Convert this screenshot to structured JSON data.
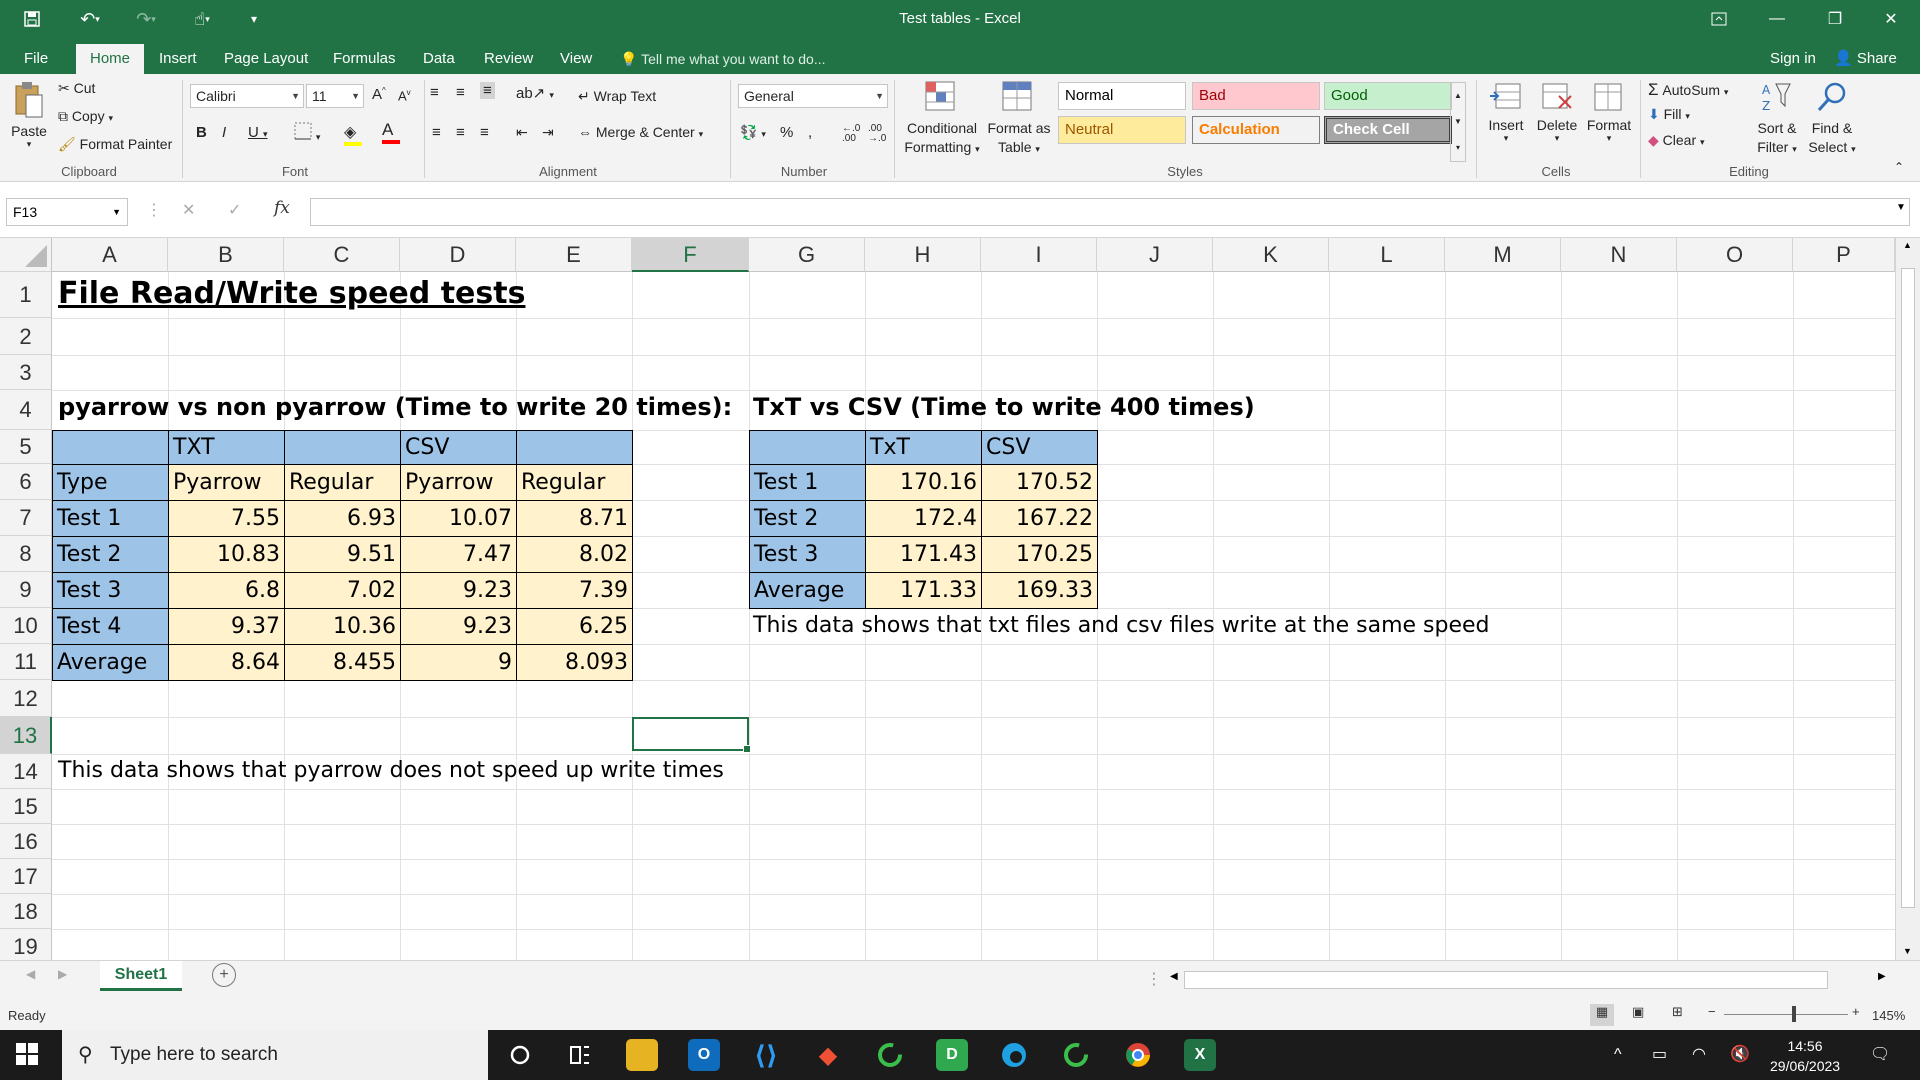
{
  "window": {
    "title": "Test tables - Excel"
  },
  "tabs": [
    "File",
    "Home",
    "Insert",
    "Page Layout",
    "Formulas",
    "Data",
    "Review",
    "View"
  ],
  "tell_me": "Tell me what you want to do...",
  "account": {
    "sign_in": "Sign in",
    "share": "Share"
  },
  "ribbon": {
    "clipboard": {
      "paste": "Paste",
      "cut": "Cut",
      "copy": "Copy",
      "format_painter": "Format Painter",
      "label": "Clipboard"
    },
    "font": {
      "name": "Calibri",
      "size": "11",
      "label": "Font"
    },
    "alignment": {
      "wrap_text": "Wrap Text",
      "merge_center": "Merge & Center",
      "label": "Alignment"
    },
    "number": {
      "format": "General",
      "label": "Number"
    },
    "styles": {
      "conditional_1": "Conditional",
      "conditional_2": "Formatting",
      "format_as_1": "Format as",
      "format_as_2": "Table",
      "items": [
        {
          "name": "Normal",
          "bg": "#ffffff",
          "fg": "#000000"
        },
        {
          "name": "Bad",
          "bg": "#ffc7ce",
          "fg": "#9c0006"
        },
        {
          "name": "Good",
          "bg": "#c6efce",
          "fg": "#006100"
        },
        {
          "name": "Neutral",
          "bg": "#ffeb9c",
          "fg": "#9c5700"
        },
        {
          "name": "Calculation",
          "bg": "#f2f2f2",
          "fg": "#fa7d00"
        },
        {
          "name": "Check Cell",
          "bg": "#a5a5a5",
          "fg": "#ffffff"
        }
      ],
      "label": "Styles"
    },
    "cells": {
      "insert": "Insert",
      "delete": "Delete",
      "format": "Format",
      "label": "Cells"
    },
    "editing": {
      "autosum": "AutoSum",
      "fill": "Fill",
      "clear": "Clear",
      "sort_1": "Sort &",
      "sort_2": "Filter",
      "find_1": "Find &",
      "find_2": "Select",
      "label": "Editing"
    }
  },
  "formula_bar": {
    "name_box": "F13",
    "formula": ""
  },
  "columns": [
    "A",
    "B",
    "C",
    "D",
    "E",
    "F",
    "G",
    "H",
    "I",
    "J",
    "K",
    "L",
    "M",
    "N",
    "O",
    "P"
  ],
  "rows": [
    "1",
    "2",
    "3",
    "4",
    "5",
    "6",
    "7",
    "8",
    "9",
    "10",
    "11",
    "12",
    "13",
    "14",
    "15",
    "16",
    "17",
    "18",
    "19"
  ],
  "sheet": {
    "title": "File Read/Write speed tests",
    "table1": {
      "heading": "pyarrow vs non pyarrow (Time to write 20 times):",
      "group_row": [
        "",
        "TXT",
        "",
        "CSV",
        ""
      ],
      "header_row": [
        "Type",
        "Pyarrow",
        "Regular",
        "Pyarrow",
        "Regular"
      ],
      "rows": [
        [
          "Test 1",
          "7.55",
          "6.93",
          "10.07",
          "8.71"
        ],
        [
          "Test 2",
          "10.83",
          "9.51",
          "7.47",
          "8.02"
        ],
        [
          "Test 3",
          "6.8",
          "7.02",
          "9.23",
          "7.39"
        ],
        [
          "Test 4",
          "9.37",
          "10.36",
          "9.23",
          "6.25"
        ],
        [
          "Average",
          "8.64",
          "8.455",
          "9",
          "8.093"
        ]
      ],
      "note": "This data shows that pyarrow does not speed up write times"
    },
    "table2": {
      "heading": "TxT vs CSV (Time to write 400 times)",
      "header_row": [
        "",
        "TxT",
        "CSV"
      ],
      "rows": [
        [
          "Test 1",
          "170.16",
          "170.52"
        ],
        [
          "Test 2",
          "172.4",
          "167.22"
        ],
        [
          "Test 3",
          "171.43",
          "170.25"
        ],
        [
          "Average",
          "171.33",
          "169.33"
        ]
      ],
      "note": "This data shows that txt files and csv files write at the same speed"
    }
  },
  "sheet_tab": "Sheet1",
  "status": {
    "ready": "Ready",
    "zoom": "145%"
  },
  "taskbar": {
    "search_placeholder": "Type here to search",
    "time": "14:56",
    "date": "29/06/2023"
  },
  "colors": {
    "excel_green": "#217346",
    "header_blue": "#9dc3e6",
    "data_cream": "#fff2cc"
  }
}
